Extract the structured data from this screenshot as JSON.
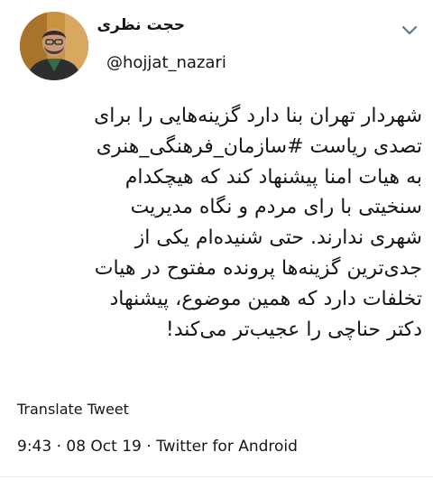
{
  "tweet": {
    "author": {
      "display_name": "حجت نظری",
      "handle": "@hojjat_nazari",
      "avatar_icon": "profile-photo"
    },
    "text": "شهردار تهران بنا دارد گزینه‌هایی را برای\nتصدی ریاست #سازمان_فرهنگی_هنری\nبه هیات امنا پیشنهاد کند که هیچکدام\nسنخیتی با رای مردم و نگاه مدیریت\nشهری ندارند. حتی شنیده‌ام یکی از\nجدی‌ترین گزینه‌ها پرونده مفتوح در هیات\nتخلفات دارد که همین موضوع، پیشنهاد\nدکتر حناچی را عجیب‌تر می‌کند!",
    "translate_label": "Translate Tweet",
    "timestamp_line": "9:43 · 08 Oct 19 · Twitter for Android",
    "menu_icon": "chevron-down-icon"
  },
  "colors": {
    "text": "#14171a",
    "chevron": "#657786",
    "divider": "#e6ecf0"
  }
}
